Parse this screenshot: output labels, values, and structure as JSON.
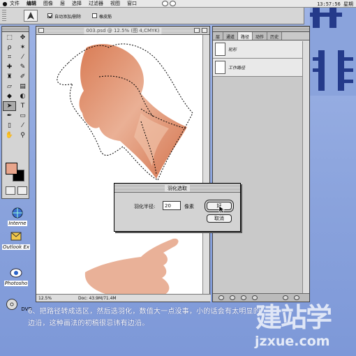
{
  "menubar": {
    "items": [
      "文件",
      "编辑",
      "图像",
      "层",
      "选择",
      "过滤器",
      "视图",
      "窗口"
    ],
    "active_index": 7,
    "clock": "13:57:56 星期"
  },
  "options_bar": {
    "auto_add_delete_label": "自动添加/删除",
    "rubber_band_label": "橡皮筋"
  },
  "document": {
    "title": "003.psd @ 12.5% (图 4,CMYK)",
    "zoom": "12.5%",
    "doc_size": "Doc: 43.9M/71.4M"
  },
  "panel": {
    "tabs": [
      "层",
      "通道",
      "路径",
      "动作",
      "历史"
    ],
    "active_tab": 2,
    "paths": [
      "轮形",
      "工作路径"
    ]
  },
  "dialog": {
    "title": "羽化选取",
    "radius_label": "羽化半径:",
    "radius_value": "20",
    "unit_label": "像素",
    "ok_label": "好",
    "cancel_label": "取消"
  },
  "desktop_icons": [
    "Interne",
    "Outlook Ex",
    "Photosho",
    "DVD"
  ],
  "caption": {
    "line1": "6、把路径转成选区，然后选羽化，数值大一点没事，小的话会有太明显的",
    "line2": "边沿，这种画法的初稿很忌讳有边沿。"
  },
  "watermark": {
    "top": "建站学",
    "bottom": "jzxue.com"
  },
  "colors": {
    "desktop": "#8ea7df",
    "foreground_swatch": "#e8a58c",
    "skin": "#e49877"
  }
}
